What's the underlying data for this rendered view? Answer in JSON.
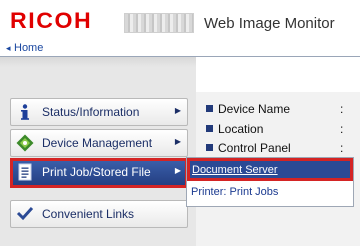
{
  "header": {
    "brand": "RICOH",
    "model_name": "",
    "app_title": "Web Image Monitor"
  },
  "breadcrumb": {
    "home_label": "Home"
  },
  "menu": [
    {
      "label": "Status/Information",
      "icon": "info-icon",
      "active": false
    },
    {
      "label": "Device Management",
      "icon": "device-management-icon",
      "active": false
    },
    {
      "label": "Print Job/Stored File",
      "icon": "document-icon",
      "active": true
    },
    {
      "label": "Convenient Links",
      "icon": "link-check-icon",
      "active": false
    }
  ],
  "info": [
    {
      "label": "Device Name",
      "sep": ":"
    },
    {
      "label": "Location",
      "sep": ":"
    },
    {
      "label": "Control Panel",
      "sep": ":"
    }
  ],
  "submenu": [
    {
      "label": "Document Server",
      "selected": true
    },
    {
      "label": "Printer: Print Jobs",
      "selected": false
    }
  ],
  "colors": {
    "brand_red": "#e00000",
    "nav_blue": "#1b2e66",
    "active_blue": "#2b4a95",
    "highlight_red": "#d42424"
  }
}
